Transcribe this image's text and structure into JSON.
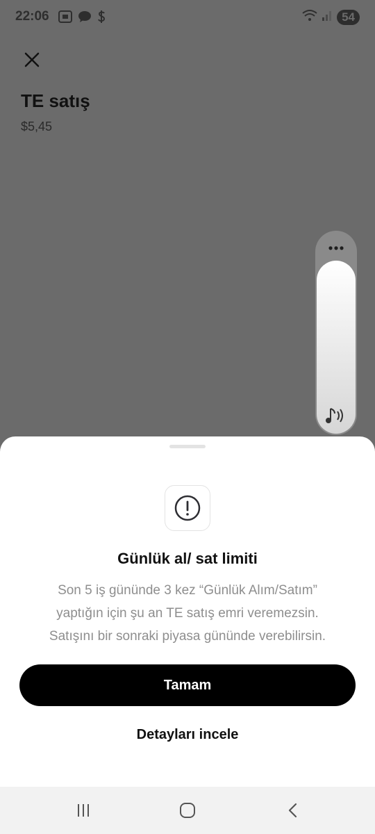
{
  "status_bar": {
    "time": "22:06",
    "battery": "54",
    "left_icons": [
      "screenshot-icon",
      "chat-bubble-icon",
      "dollar-icon"
    ],
    "right_icons": [
      "wifi-icon",
      "signal-icon",
      "battery-icon"
    ]
  },
  "page": {
    "title": "TE satış",
    "price": "$5,45"
  },
  "volume": {
    "level": 0.86,
    "icons": [
      "more-icon",
      "music-volume-icon"
    ]
  },
  "sheet": {
    "icon": "alert-circle-icon",
    "title": "Günlük al/ sat limiti",
    "message_lines": [
      "Son 5 iş gününde 3 kez “Günlük Alım/Satım”",
      "yaptığın için şu an TE satış emri veremezsin.",
      "Satışını bir sonraki piyasa gününde verebilirsin."
    ],
    "primary_button": "Tamam",
    "secondary_button": "Detayları incele"
  },
  "nav_bar": {
    "buttons": [
      "recent-apps-icon",
      "home-icon",
      "back-icon"
    ]
  },
  "colors": {
    "overlay": "#6b6b6b",
    "primary_button_bg": "#000000",
    "message_text": "#8e8e8e"
  }
}
